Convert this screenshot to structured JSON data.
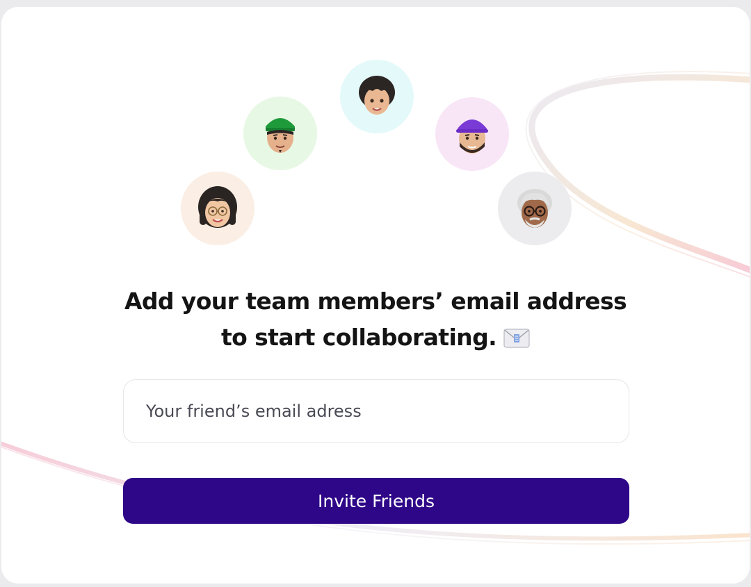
{
  "heading": {
    "line1": "Add your team members’ email address",
    "line2": "to start collaborating."
  },
  "icons": {
    "heading_icon": "envelope-icon",
    "avatars": [
      "memoji-woman-glasses-icon",
      "memoji-man-green-cap-icon",
      "memoji-child-icon",
      "memoji-man-purple-cap-icon",
      "memoji-older-man-glasses-icon"
    ]
  },
  "email_input": {
    "placeholder": "Your friend’s email adress",
    "value": ""
  },
  "invite_button": {
    "label": "Invite Friends"
  },
  "colors": {
    "accent": "#2e0688",
    "avatar_backgrounds": [
      "#fbeee4",
      "#e7f8e4",
      "#e4f9fa",
      "#f8e6f7",
      "#ececee"
    ]
  }
}
